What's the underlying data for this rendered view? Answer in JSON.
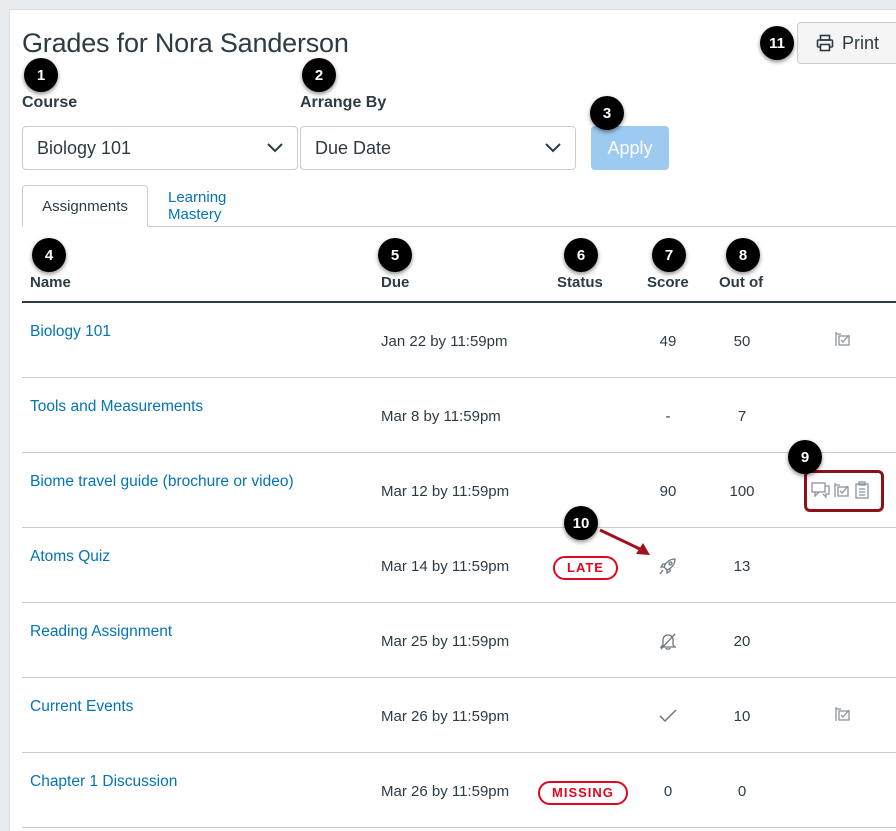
{
  "page": {
    "title": "Grades for Nora Sanderson"
  },
  "print_button": {
    "label": "Print",
    "icon": "printer-icon"
  },
  "filters": {
    "course": {
      "label": "Course",
      "selected": "Biology 101"
    },
    "arrange_by": {
      "label": "Arrange By",
      "selected": "Due Date"
    },
    "apply_label": "Apply"
  },
  "tabs": [
    {
      "label": "Assignments",
      "active": true
    },
    {
      "label": "Learning Mastery",
      "active": false
    }
  ],
  "columns": {
    "name": "Name",
    "due": "Due",
    "status": "Status",
    "score": "Score",
    "out_of": "Out of"
  },
  "rows": [
    {
      "name": "Biology 101",
      "due": "Jan 22 by 11:59pm",
      "status": "",
      "score": "49",
      "out_of": "50",
      "icons": [
        "rubric-icon"
      ]
    },
    {
      "name": "Tools and Measurements",
      "due": "Mar 8 by 11:59pm",
      "status": "",
      "score": "-",
      "out_of": "7",
      "icons": []
    },
    {
      "name": "Biome travel guide (brochure or video)",
      "due": "Mar 12 by 11:59pm",
      "status": "",
      "score": "90",
      "out_of": "100",
      "icons": [
        "comment-icon",
        "rubric-icon",
        "clipboard-icon"
      ]
    },
    {
      "name": "Atoms Quiz",
      "due": "Mar 14 by 11:59pm",
      "status": "LATE",
      "score_icon": "rocket-icon",
      "out_of": "13",
      "icons": []
    },
    {
      "name": "Reading Assignment",
      "due": "Mar 25 by 11:59pm",
      "status": "",
      "score_icon": "muted-bell-icon",
      "out_of": "20",
      "icons": []
    },
    {
      "name": "Current Events",
      "due": "Mar 26 by 11:59pm",
      "status": "",
      "score_icon": "checkmark-icon",
      "out_of": "10",
      "icons": [
        "rubric-icon"
      ]
    },
    {
      "name": "Chapter 1 Discussion",
      "due": "Mar 26 by 11:59pm",
      "status": "MISSING",
      "score": "0",
      "out_of": "0",
      "icons": []
    }
  ],
  "callouts": [
    "1",
    "2",
    "3",
    "4",
    "5",
    "6",
    "7",
    "8",
    "9",
    "10",
    "11"
  ],
  "colors": {
    "link": "#0374b5",
    "status_red": "#e0061f",
    "apply_disabled": "#9ccaf0",
    "highlight": "#8b1219",
    "text": "#2d3b45"
  }
}
